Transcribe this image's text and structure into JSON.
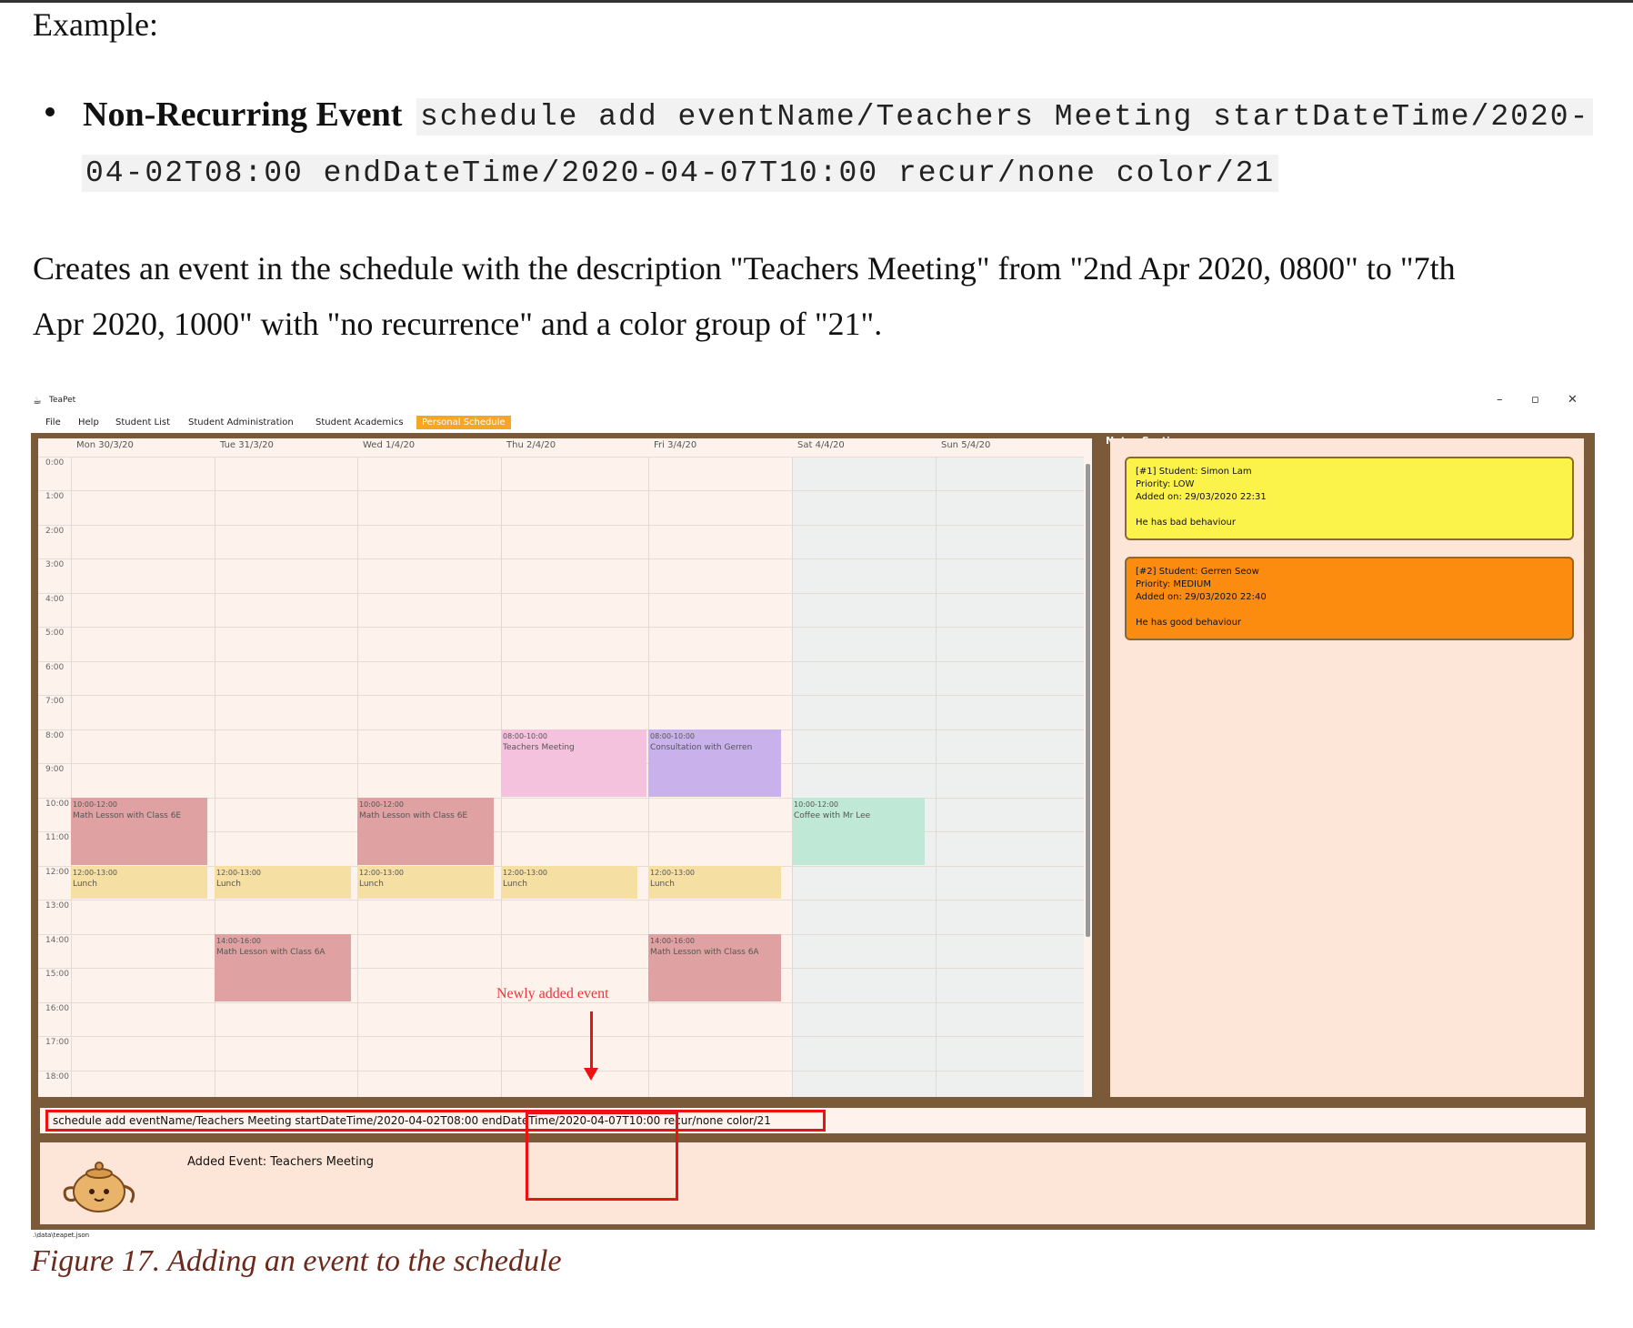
{
  "doc": {
    "example_label": "Example:",
    "bullet_title": "Non-Recurring Event",
    "code_line1": "schedule add eventName/Teachers Meeting startDateTime/2020-",
    "code_line2": "04-02T08:00 endDateTime/2020-04-07T10:00 recur/none color/21",
    "description_line1": "Creates an event in the schedule with the description \"Teachers Meeting\" from \"2nd Apr 2020, 0800\" to \"7th",
    "description_line2": "Apr 2020, 1000\" with \"no recurrence\" and a color group of \"21\".",
    "caption": "Figure 17. Adding an event to the schedule"
  },
  "app": {
    "title": "TeaPet",
    "logo_icon": "teapot-icon",
    "window_buttons": [
      "–",
      "▫",
      "✕"
    ],
    "menu": [
      "File",
      "Help",
      "Student List",
      "Student Administration",
      "Student Academics",
      "Personal Schedule"
    ],
    "active_tab": "Personal Schedule",
    "days": [
      "Mon 30/3/20",
      "Tue 31/3/20",
      "Wed 1/4/20",
      "Thu 2/4/20",
      "Fri 3/4/20",
      "Sat 4/4/20",
      "Sun 5/4/20"
    ],
    "times": [
      "0:00",
      "1:00",
      "2:00",
      "3:00",
      "4:00",
      "5:00",
      "6:00",
      "7:00",
      "8:00",
      "9:00",
      "10:00",
      "11:00",
      "12:00",
      "13:00",
      "14:00",
      "15:00",
      "16:00",
      "17:00",
      "18:00"
    ],
    "events": [
      {
        "time": "08:00-10:00",
        "title": "Teachers Meeting",
        "color": "#f4c2dc"
      },
      {
        "time": "08:00-10:00",
        "title": "Consultation with Gerren",
        "color": "#c9b2ec"
      },
      {
        "time": "10:00-12:00",
        "title": "Math Lesson with Class 6E",
        "color": "#dfa1a1"
      },
      {
        "time": "10:00-12:00",
        "title": "Math Lesson with Class 6E",
        "color": "#dfa1a1"
      },
      {
        "time": "10:00-12:00",
        "title": "Coffee with Mr Lee",
        "color": "#bfe8d6"
      },
      {
        "time": "12:00-13:00",
        "title": "Lunch",
        "color": "#f6dfa2"
      },
      {
        "time": "12:00-13:00",
        "title": "Lunch",
        "color": "#f6dfa2"
      },
      {
        "time": "12:00-13:00",
        "title": "Lunch",
        "color": "#f6dfa2"
      },
      {
        "time": "12:00-13:00",
        "title": "Lunch",
        "color": "#f6dfa2"
      },
      {
        "time": "12:00-13:00",
        "title": "Lunch",
        "color": "#f6dfa2"
      },
      {
        "time": "14:00-16:00",
        "title": "Math Lesson with Class 6A",
        "color": "#dfa1a1"
      },
      {
        "time": "14:00-16:00",
        "title": "Math Lesson with Class 6A",
        "color": "#dfa1a1"
      }
    ],
    "annotation": "Newly added event",
    "notes_title": "Notes Section:",
    "notes": [
      {
        "line1": "[#1] Student: Simon Lam",
        "line2": "Priority: LOW",
        "line3": "Added on: 29/03/2020 22:31",
        "body": "He has bad behaviour",
        "color": "#fbf24a"
      },
      {
        "line1": "[#2] Student: Gerren Seow",
        "line2": "Priority: MEDIUM",
        "line3": "Added on: 29/03/2020 22:40",
        "body": "He has good behaviour",
        "color": "#fb8c10"
      }
    ],
    "command": "schedule add eventName/Teachers Meeting startDateTime/2020-04-02T08:00 endDateTime/2020-04-07T10:00 recur/none color/21",
    "result": "Added Event: Teachers Meeting",
    "status_path": ".\\data\\teapet.json"
  }
}
